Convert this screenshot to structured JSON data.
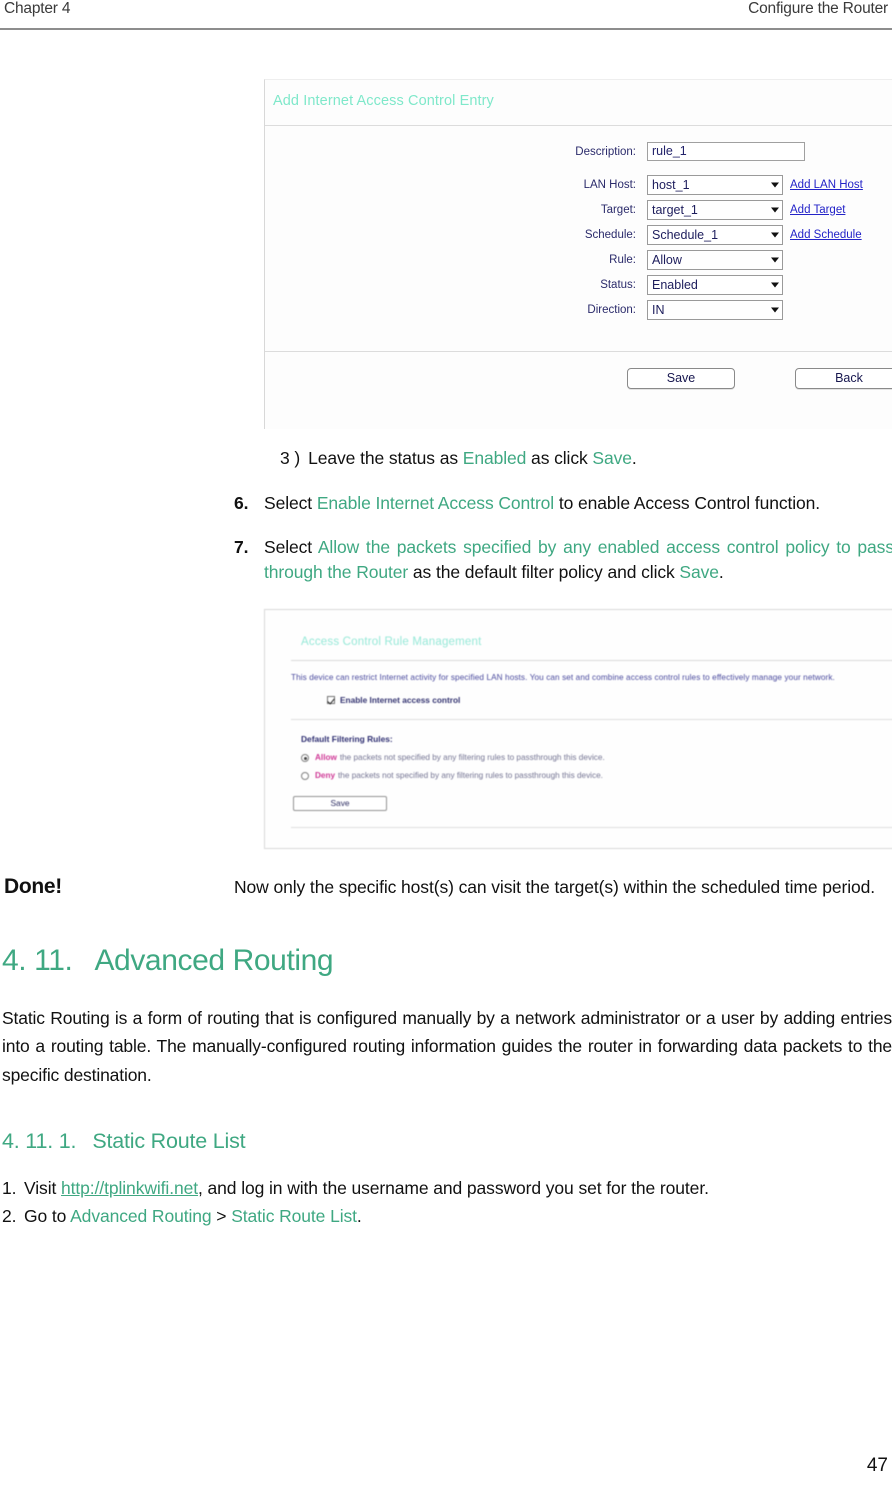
{
  "header": {
    "chapter": "Chapter 4",
    "section": "Configure the Router"
  },
  "router_form": {
    "title": "Add Internet Access Control Entry",
    "fields": [
      {
        "label": "Description:",
        "value": "rule_1",
        "type": "text",
        "link": ""
      },
      {
        "label": "LAN Host:",
        "value": "host_1",
        "type": "select",
        "link": "Add LAN Host"
      },
      {
        "label": "Target:",
        "value": "target_1",
        "type": "select",
        "link": "Add Target"
      },
      {
        "label": "Schedule:",
        "value": "Schedule_1",
        "type": "select",
        "link": "Add Schedule"
      },
      {
        "label": "Rule:",
        "value": "Allow",
        "type": "select",
        "link": ""
      },
      {
        "label": "Status:",
        "value": "Enabled",
        "type": "select",
        "link": ""
      },
      {
        "label": "Direction:",
        "value": "IN",
        "type": "select",
        "link": ""
      }
    ],
    "save_label": "Save",
    "back_label": "Back"
  },
  "step3": {
    "number": "3 )",
    "part1": "Leave the status as ",
    "accent1": "Enabled",
    "part2": " as click ",
    "accent2": "Save",
    "part3": "."
  },
  "step6": {
    "number": "6.",
    "part1": "Select ",
    "accent1": "Enable Internet Access Control",
    "part2": " to enable Access Control function."
  },
  "step7": {
    "number": "7.",
    "part1": "Select ",
    "accent1": "Allow the packets specified by any enabled access control policy to pass through the Router",
    "part2": " as the default filter policy and click ",
    "accent2": "Save",
    "part3": "."
  },
  "acl_panel": {
    "title": "Access Control Rule Management",
    "description": "This device can restrict Internet activity for specified LAN hosts. You can set and combine access control rules to effectively manage your network.",
    "checkbox_label": "Enable Internet access control",
    "default_rules_label": "Default Filtering Rules:",
    "radio_allow_strong": "Allow",
    "radio_allow_rest": "the packets not specified by any filtering rules to passthrough this device.",
    "radio_deny_strong": "Deny",
    "radio_deny_rest": "the packets not specified by any filtering rules to passthrough this device.",
    "save_label": "Save"
  },
  "done": {
    "label": "Done!",
    "text": "Now only the specific host(s) can visit the target(s) within the scheduled time period."
  },
  "section": {
    "number": "4. 11.",
    "title": "Advanced Routing",
    "paragraph": "Static Routing is a form of routing that is configured manually by a network administrator or a user by adding entries into a routing table. The manually-configured routing information guides the router in forwarding data packets to the specific destination."
  },
  "subsection": {
    "number": "4. 11. 1.",
    "title": "Static Route List",
    "item1": {
      "n": "1.",
      "part1": "Visit ",
      "link": "http://tplinkwifi.net",
      "part2": ", and log in with the username and password you set for the router."
    },
    "item2": {
      "n": "2.",
      "part1": "Go to ",
      "accent1": "Advanced Routing",
      "part2": " > ",
      "accent2": "Static Route List",
      "part3": "."
    }
  },
  "page_number": "47",
  "colors": {
    "accent_green": "#3fa882",
    "panel_title_mint": "#7fe8ca",
    "link_blue": "#2323c8",
    "label_navy": "#2b2b6b",
    "radio_magenta": "#cc2a8f"
  }
}
